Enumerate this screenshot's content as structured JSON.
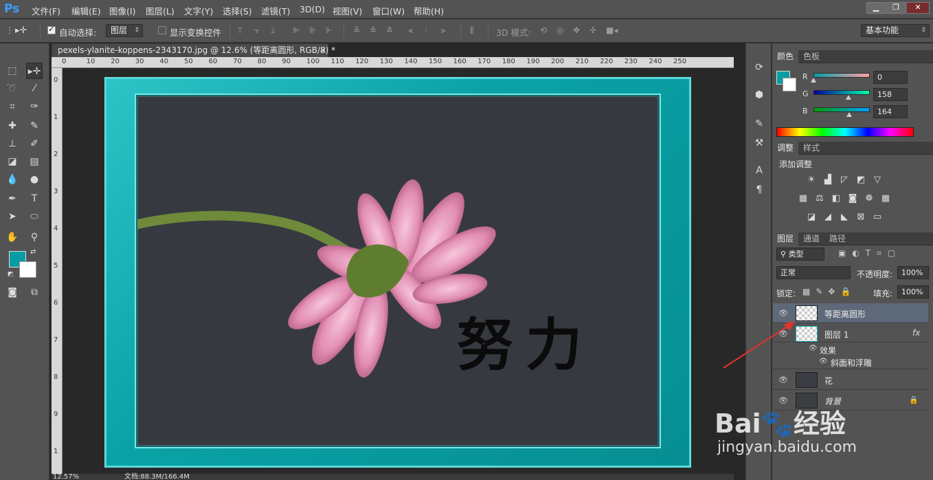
{
  "app": {
    "logo": "Ps"
  },
  "menu": [
    "文件(F)",
    "编辑(E)",
    "图像(I)",
    "图层(L)",
    "文字(Y)",
    "选择(S)",
    "滤镜(T)",
    "3D(D)",
    "视图(V)",
    "窗口(W)",
    "帮助(H)"
  ],
  "window_controls": {
    "minimize": "▁",
    "restore": "❐",
    "close": "✕"
  },
  "options": {
    "auto_select_label": "自动选择:",
    "auto_select_checked": true,
    "auto_select_value": "图层",
    "transform_controls_label": "显示变换控件",
    "transform_controls_checked": false,
    "mode_3d_label": "3D 模式:",
    "workspace": "基本功能"
  },
  "document": {
    "tab_title": "pexels-ylanite-koppens-2343170.jpg @ 12.6% (等距离圆形, RGB/8) *",
    "tab_close": "×",
    "ruler_ticks": [
      "0",
      "10",
      "20",
      "30",
      "40",
      "50",
      "60",
      "70",
      "80",
      "90",
      "100",
      "110",
      "120",
      "130",
      "140",
      "150",
      "160",
      "170",
      "180",
      "190",
      "200",
      "210",
      "220",
      "230",
      "240",
      "250"
    ],
    "ruler_v_ticks": [
      "0",
      "1",
      "2",
      "3",
      "4",
      "5",
      "6",
      "7",
      "8",
      "9",
      "1"
    ],
    "canvas_text": "努力",
    "zoom_status": "12.57%",
    "doc_size_status": "文档:88.3M/166.4M"
  },
  "colors": {
    "foreground": "#069ea4",
    "background": "#ffffff",
    "teal_frame": "#0aa2a6",
    "canvas_inner": "#363a40"
  },
  "color_panel": {
    "tabs": [
      "颜色",
      "色板"
    ],
    "active_tab": 0,
    "channels": [
      {
        "label": "R",
        "value": "0",
        "thumb_fraction": 0.0
      },
      {
        "label": "G",
        "value": "158",
        "thumb_fraction": 0.62
      },
      {
        "label": "B",
        "value": "164",
        "thumb_fraction": 0.64
      }
    ]
  },
  "adjust_panel": {
    "tabs": [
      "调整",
      "样式"
    ],
    "active_tab": 0,
    "title": "添加调整",
    "icons": [
      [
        "brightness-icon",
        "levels-icon",
        "curves-icon",
        "exposure-icon",
        "vibrance-icon"
      ],
      [
        "hue-saturation-icon",
        "color-balance-icon",
        "black-white-icon",
        "photo-filter-icon",
        "channel-mixer-icon",
        "color-lookup-icon"
      ],
      [
        "invert-icon",
        "posterize-icon",
        "threshold-icon",
        "selective-color-icon",
        "gradient-map-icon"
      ]
    ]
  },
  "layers_panel": {
    "tabs": [
      "图层",
      "通道",
      "路径"
    ],
    "active_tab": 0,
    "filter_kind": "类型",
    "blend_mode": "正常",
    "opacity_label": "不透明度:",
    "opacity": "100%",
    "lock_label": "锁定:",
    "fill_label": "填充:",
    "fill": "100%",
    "layers": [
      {
        "name": "等距离圆形",
        "selected": true,
        "visible": true
      },
      {
        "name": "图层 1",
        "selected": false,
        "visible": true,
        "fx": "fx"
      },
      {
        "name": "效果",
        "sub": true
      },
      {
        "name": "斜面和浮雕",
        "sub": true
      },
      {
        "name": "花",
        "selected": false,
        "visible": true
      },
      {
        "name": "背景",
        "selected": false,
        "visible": false,
        "locked": true
      }
    ]
  },
  "watermark": {
    "brand": "Bai",
    "brand_cn": "经验",
    "url": "jingyan.baidu.com"
  }
}
